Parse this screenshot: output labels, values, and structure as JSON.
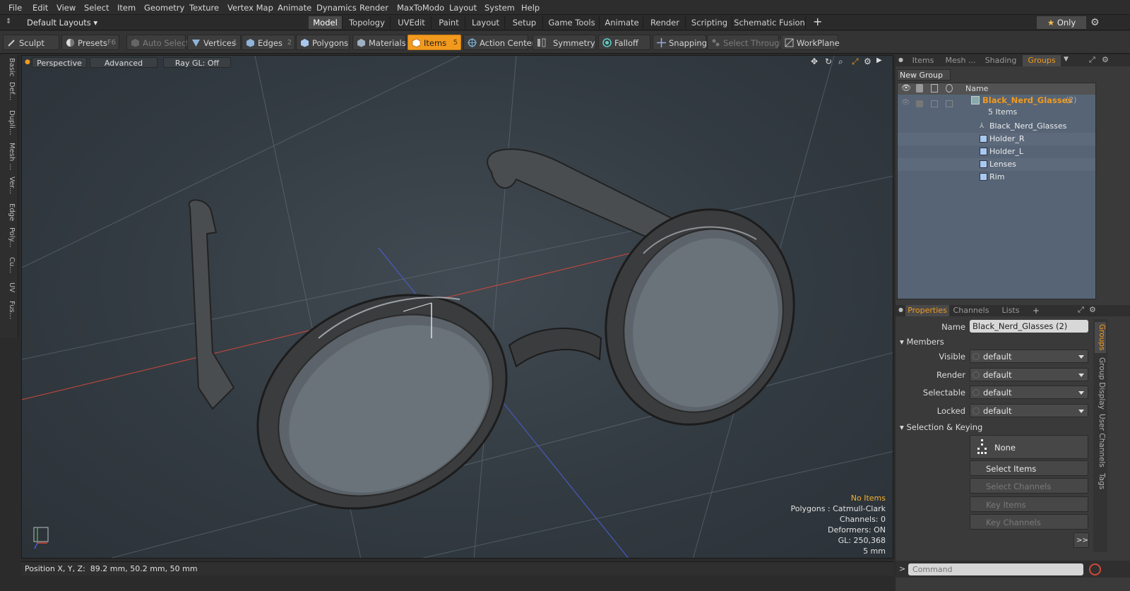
{
  "menu": [
    "File",
    "Edit",
    "View",
    "Select",
    "Item",
    "Geometry",
    "Texture",
    "Vertex Map",
    "Animate",
    "Dynamics",
    "Render",
    "MaxToModo",
    "Layout",
    "System",
    "Help"
  ],
  "layout_selector": "Default Layouts",
  "layout_tabs": [
    {
      "label": "Model",
      "active": true
    },
    {
      "label": "Topology"
    },
    {
      "label": "UVEdit"
    },
    {
      "label": "Paint"
    },
    {
      "label": "Layout"
    },
    {
      "label": "Setup"
    },
    {
      "label": "Game Tools"
    },
    {
      "label": "Animate"
    },
    {
      "label": "Render"
    },
    {
      "label": "Scripting"
    },
    {
      "label": "Schematic Fusion"
    }
  ],
  "only_button": "Only",
  "toolbar": {
    "sculpt": "Sculpt",
    "presets": "Presets",
    "presets_key": "F6",
    "auto_select": "Auto Select",
    "vertices": "Vertices",
    "vertices_key": "1",
    "edges": "Edges",
    "edges_key": "2",
    "polygons": "Polygons",
    "materials": "Materials",
    "items": "Items",
    "items_key": "5",
    "action_center": "Action Center",
    "symmetry": "Symmetry",
    "falloff": "Falloff",
    "snapping": "Snapping",
    "select_through": "Select Through",
    "workplane": "WorkPlane"
  },
  "left_tabs": [
    "Basic",
    "Def...",
    "Dupli...",
    "Mesh ...",
    "Ver...",
    "Edge",
    "Poly...",
    "Cu...",
    "UV",
    "Fus..."
  ],
  "viewport": {
    "view_mode": "Perspective",
    "advanced": "Advanced",
    "raygl": "Ray GL: Off",
    "info": {
      "items": "No Items",
      "polygons": "Polygons : Catmull-Clark",
      "channels": "Channels: 0",
      "deformers": "Deformers: ON",
      "gl": "GL: 250,368",
      "scale": "5 mm"
    }
  },
  "status_bar": "Position X, Y, Z:  89.2 mm, 50.2 mm, 50 mm",
  "right_tabs": [
    {
      "label": "Items"
    },
    {
      "label": "Mesh ..."
    },
    {
      "label": "Shading"
    },
    {
      "label": "Groups",
      "active": true
    }
  ],
  "groups": {
    "new_group": "New Group",
    "name_header": "Name",
    "group_name": "Black_Nerd_Glasses",
    "group_count": "(2)",
    "items_count": "5 Items",
    "children": [
      "Black_Nerd_Glasses",
      "Holder_R",
      "Holder_L",
      "Lenses",
      "Rim"
    ]
  },
  "props_tabs": [
    {
      "label": "Properties",
      "active": true
    },
    {
      "label": "Channels"
    },
    {
      "label": "Lists"
    }
  ],
  "properties": {
    "name_label": "Name",
    "name_value": "Black_Nerd_Glasses (2)",
    "members": "Members",
    "visible_label": "Visible",
    "visible": "default",
    "render_label": "Render",
    "render": "default",
    "selectable_label": "Selectable",
    "selectable": "default",
    "locked_label": "Locked",
    "locked": "default",
    "sel_keying": "Selection & Keying",
    "none": "None",
    "select_items": "Select Items",
    "select_channels": "Select Channels",
    "key_items": "Key Items",
    "key_channels": "Key Channels",
    "more": ">>"
  },
  "side_tabs": [
    "Groups",
    "Group Display",
    "User Channels",
    "Tags"
  ],
  "command_placeholder": "Command",
  "colors": {
    "accent": "#f29a1e",
    "x_axis": "#d0483a",
    "z_axis": "#4a5fd6"
  }
}
